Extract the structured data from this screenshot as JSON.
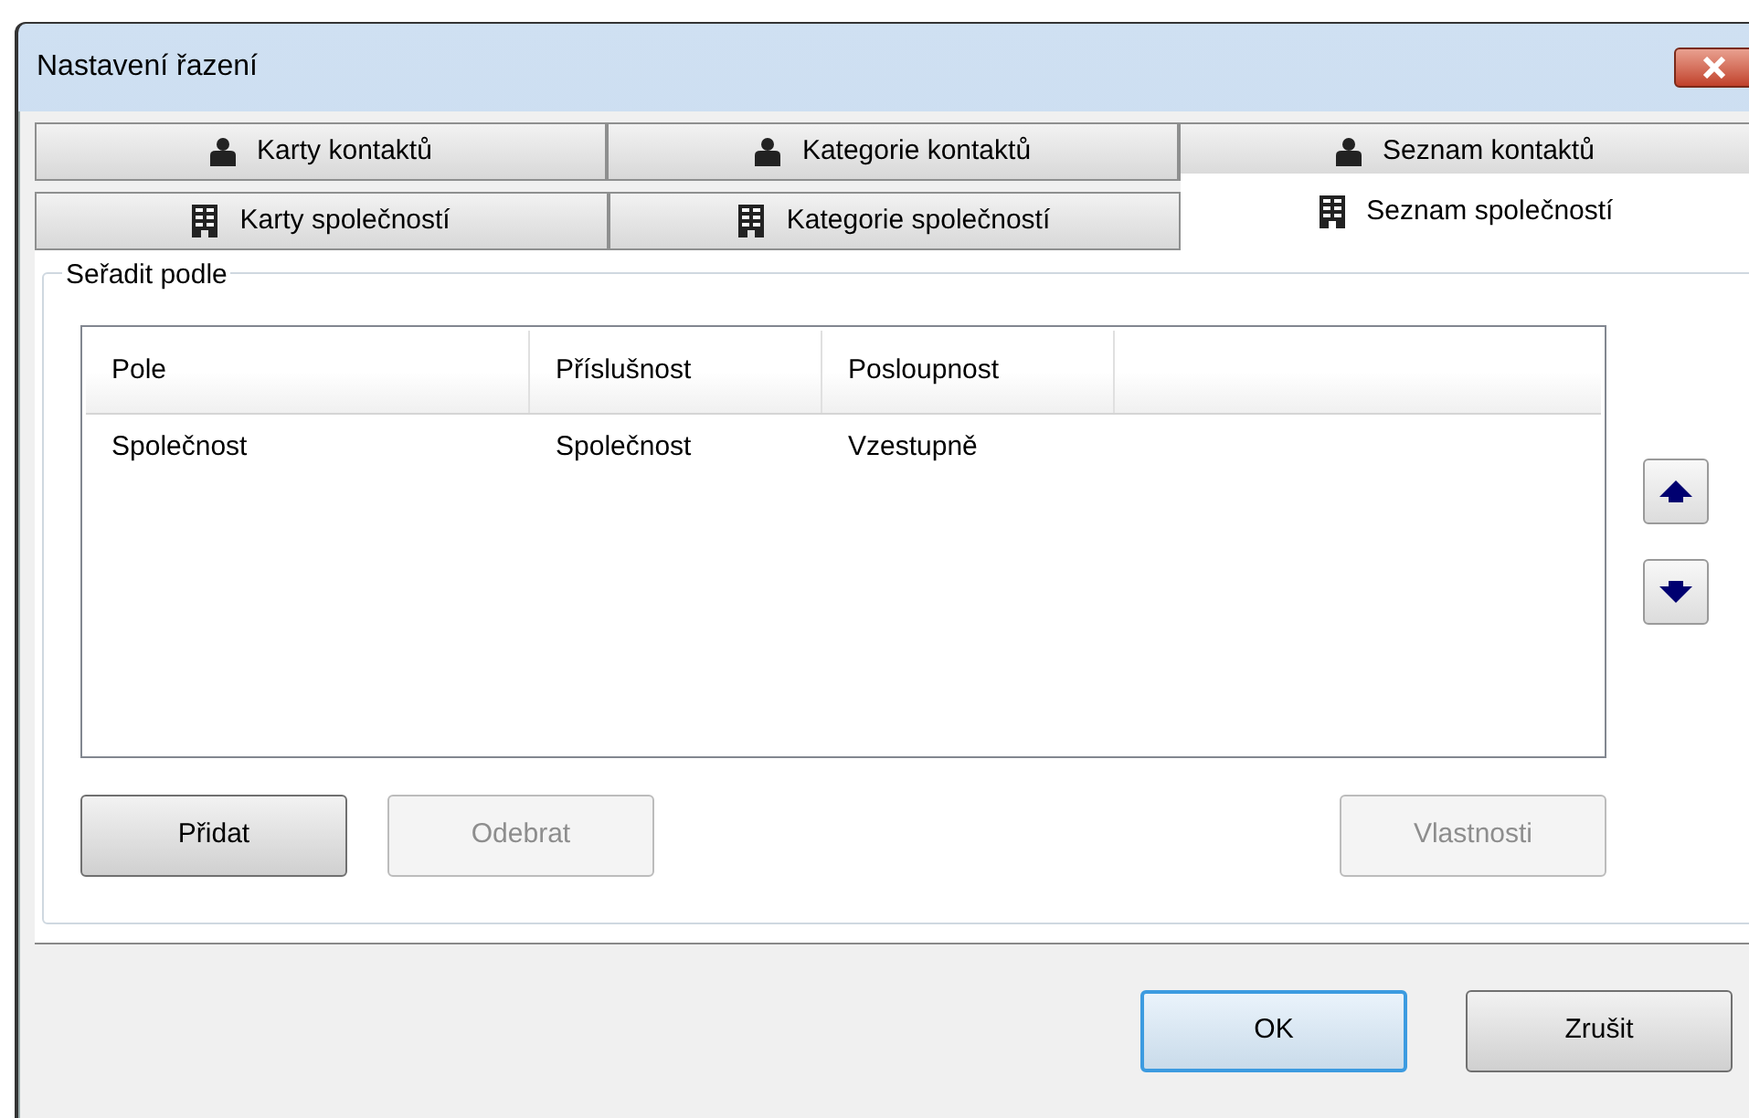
{
  "window": {
    "title": "Nastavení řazení"
  },
  "tab_rows": [
    {
      "tabs": [
        {
          "label": "Karty kontaktů",
          "kind": "person",
          "selected": false
        },
        {
          "label": "Kategorie kontaktů",
          "kind": "person",
          "selected": false
        },
        {
          "label": "Seznam kontaktů",
          "kind": "person",
          "selected": false
        }
      ]
    },
    {
      "tabs": [
        {
          "label": "Karty společností",
          "kind": "building",
          "selected": false
        },
        {
          "label": "Kategorie společností",
          "kind": "building",
          "selected": false
        },
        {
          "label": "Seznam společností",
          "kind": "building",
          "selected": true
        }
      ]
    }
  ],
  "group": {
    "title": "Seřadit podle"
  },
  "table": {
    "columns": [
      "Pole",
      "Příslušnost",
      "Posloupnost"
    ],
    "rows": [
      {
        "cells": [
          "Společnost",
          "Společnost",
          "Vzestupně"
        ],
        "selected": false
      }
    ]
  },
  "list_buttons": [
    {
      "label": "Přidat",
      "disabled": false
    },
    {
      "label": "Odebrat",
      "disabled": true
    },
    {
      "label": "Vlastnosti",
      "disabled": true
    }
  ],
  "dialog_buttons": [
    {
      "label": "OK",
      "default": true
    },
    {
      "label": "Zrušit",
      "default": false
    }
  ]
}
